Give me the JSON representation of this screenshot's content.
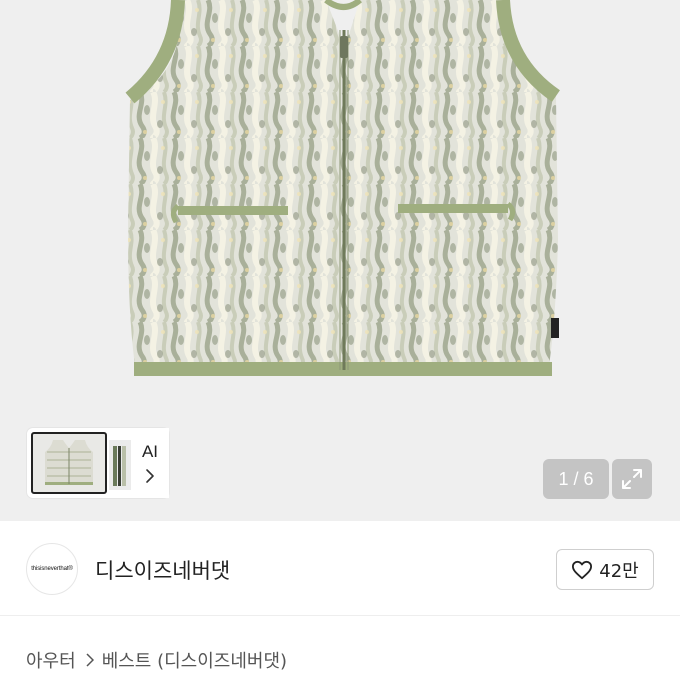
{
  "gallery": {
    "ai_label": "AI",
    "page_counter": "1 / 6",
    "colors": {
      "background": "#efefef",
      "vest_base": "#e3e3dc",
      "trim": "#9fae7f"
    }
  },
  "seller": {
    "logo_text": "thisisneverthat®",
    "name": "디스이즈네버댓"
  },
  "like": {
    "count": "42만"
  },
  "breadcrumb": {
    "category": "아우터",
    "subcategory": "베스트 (디스이즈네버댓)"
  }
}
